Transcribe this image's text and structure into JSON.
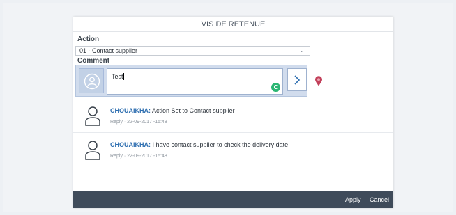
{
  "dialog": {
    "title": "VIS DE RETENUE"
  },
  "form": {
    "action_label": "Action",
    "action_value": "01 - Contact supplier",
    "comment_label": "Comment",
    "comment_value": "Test",
    "status_badge": "C"
  },
  "feed": [
    {
      "author": "CHOUAIKHA:",
      "text": "Action Set to Contact supplier",
      "reply": "Reply",
      "separator": "·",
      "timestamp": "22-09-2017 -15:48"
    },
    {
      "author": "CHOUAIKHA:",
      "text": "I have contact supplier to check the delivery date",
      "reply": "Reply",
      "separator": "·",
      "timestamp": "22-09-2017 -15:48"
    }
  ],
  "footer": {
    "apply_label": "Apply",
    "cancel_label": "Cancel"
  },
  "colors": {
    "footer_bg": "#3f4b5a",
    "author_link": "#2f6fb0",
    "status_green": "#2bb673",
    "comment_box_bg": "#d1dced"
  },
  "icons": {
    "avatar": "user-circle-icon",
    "send": "chevron-right-icon",
    "pin": "map-pin-icon",
    "feed_avatar": "user-icon",
    "dropdown": "chevron-down-icon"
  }
}
